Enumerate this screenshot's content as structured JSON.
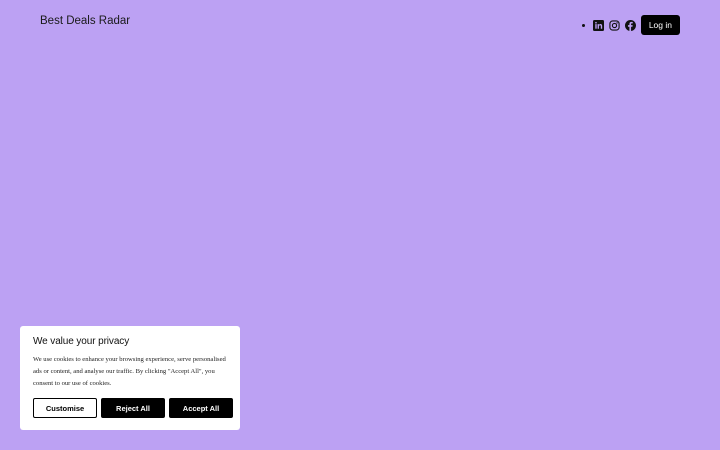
{
  "header": {
    "site_title": "Best Deals Radar",
    "login_label": "Log in",
    "social_icons": [
      "linkedin-icon",
      "instagram-icon",
      "facebook-icon"
    ]
  },
  "cookie_banner": {
    "title": "We value your privacy",
    "text": "We use cookies to enhance your browsing experience, serve personalised ads or content, and analyse our traffic. By clicking \"Accept All\", you consent to our use of cookies.",
    "customise_label": "Customise",
    "reject_label": "Reject All",
    "accept_label": "Accept All"
  },
  "colors": {
    "background": "#bca1f3",
    "button": "#000000",
    "panel": "#ffffff"
  }
}
